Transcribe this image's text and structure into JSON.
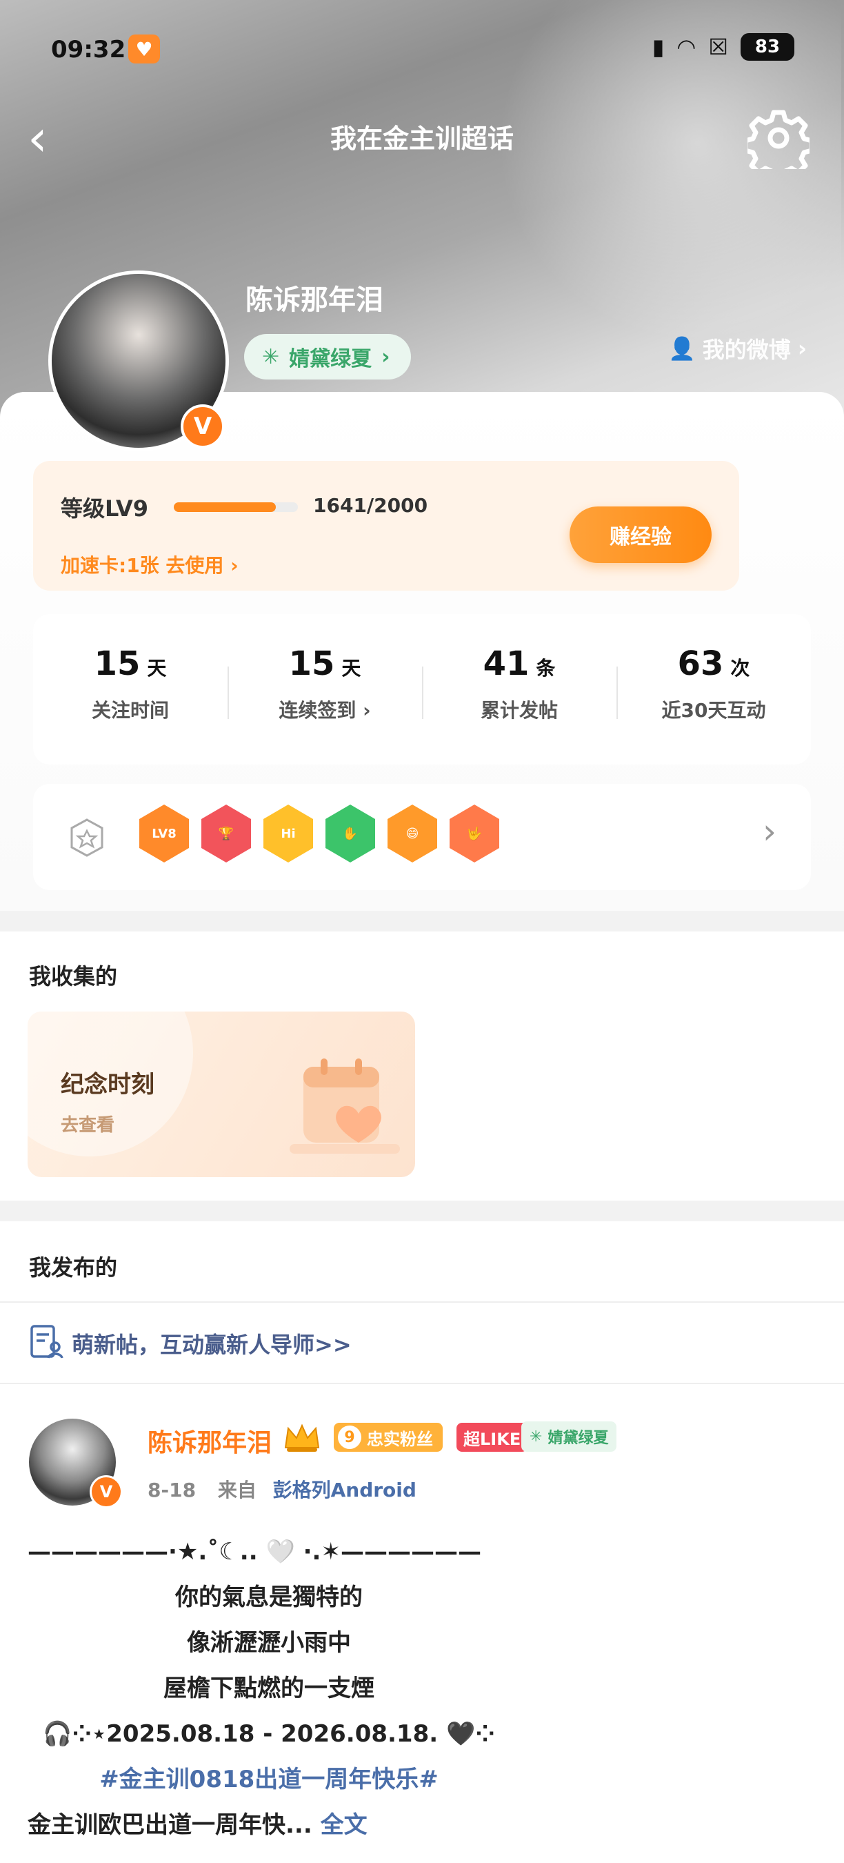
{
  "status": {
    "time": "09:32",
    "battery": "83"
  },
  "nav": {
    "title": "我在金主训超话"
  },
  "profile": {
    "username": "陈诉那年泪",
    "team_label": "婧黛绿夏",
    "my_weibo": "我的微博"
  },
  "level": {
    "label": "等级LV9",
    "progress_text": "1641/2000",
    "progress": 0.8205,
    "speed_card": "加速卡:1张 去使用",
    "earn_button": "赚经验"
  },
  "stats": [
    {
      "value": "15",
      "unit": "天",
      "label": "关注时间"
    },
    {
      "value": "15",
      "unit": "天",
      "label": "连续签到"
    },
    {
      "value": "41",
      "unit": "条",
      "label": "累计发帖"
    },
    {
      "value": "63",
      "unit": "次",
      "label": "近30天互动"
    }
  ],
  "badges": [
    {
      "name": "lv8-badge",
      "text": "LV8",
      "color": "#ff8a2a"
    },
    {
      "name": "trophy-badge",
      "text": "🏆",
      "color": "#f2545b"
    },
    {
      "name": "hi-badge",
      "text": "Hi",
      "color": "#ffc02a"
    },
    {
      "name": "hand-badge",
      "text": "✋",
      "color": "#3cc46a"
    },
    {
      "name": "face-badge",
      "text": "😄",
      "color": "#ff9a2a"
    },
    {
      "name": "rock-badge",
      "text": "🤟",
      "color": "#ff7a4a"
    }
  ],
  "collection": {
    "section_title": "我收集的",
    "card_title": "纪念时刻",
    "card_sub": "去查看"
  },
  "posts_section": {
    "title": "我发布的",
    "tip": "萌新帖，互动赢新人导师>>"
  },
  "post": {
    "author": "陈诉那年泪",
    "fan_level": "9",
    "fan_label": "忠实粉丝",
    "like_label": "超LIKE",
    "team_label": "婧黛绿夏",
    "date": "8-18",
    "source_prefix": "来自",
    "source": "彭格列Android",
    "lines": [
      "——————·★.˚☾.. 🤍 ·.✶——————",
      "你的氣息是獨特的",
      "像淅瀝瀝小雨中",
      "屋檐下點燃的一支煙",
      "🎧⁘⋆2025.08.18 - 2026.08.18. 🖤⁘",
      "#金主训0818出道一周年快乐#",
      "金主训欧巴出道一周年快..."
    ],
    "more_label": "全文"
  },
  "colors": {
    "accent": "#ff8a1e",
    "link": "#4a6ea9",
    "team_green": "#3aa66a"
  }
}
